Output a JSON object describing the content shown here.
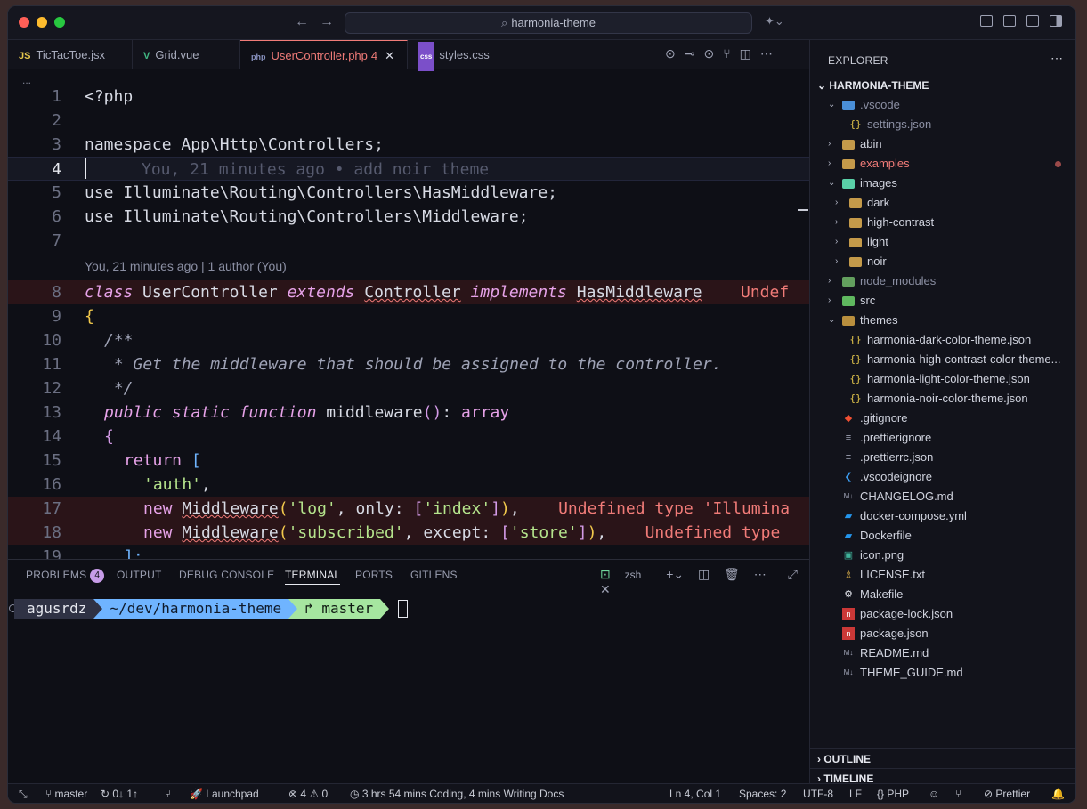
{
  "window": {
    "search_text": "harmonia-theme"
  },
  "tabs": [
    {
      "icon": "JS",
      "label": "TicTacToe.jsx"
    },
    {
      "icon": "V",
      "label": "Grid.vue"
    },
    {
      "icon": "php",
      "label": "UserController.php",
      "badge": "4"
    },
    {
      "icon": "css",
      "label": "styles.css"
    }
  ],
  "breadcrumb": "...",
  "code": {
    "line_numbers": [
      "1",
      "2",
      "3",
      "4",
      "5",
      "6",
      "7",
      "8",
      "9",
      "10",
      "11",
      "12",
      "13",
      "14",
      "15",
      "16",
      "17",
      "18",
      "19"
    ],
    "l1": "<?php",
    "l3": "namespace App\\Http\\Controllers;",
    "l4_ghost": "You, 21 minutes ago • add noir theme",
    "l5": "use Illuminate\\Routing\\Controllers\\HasMiddleware;",
    "l6": "use Illuminate\\Routing\\Controllers\\Middleware;",
    "blame": "You, 21 minutes ago | 1 author (You)",
    "l8_class": "class",
    "l8_name": "UserController",
    "l8_extends": "extends",
    "l8_parent": "Controller",
    "l8_implements": "implements",
    "l8_iface": "HasMiddleware",
    "l8_err": "Undef",
    "l10": "/**",
    "l11": " * Get the middleware that should be assigned to the controller.",
    "l12": " */",
    "l13_mods": "public static function",
    "l13_name": "middleware",
    "l13_ret": "array",
    "l15_return": "return",
    "l16_str": "'auth'",
    "l17_new": "new",
    "l17_cls": "Middleware",
    "l17_a": "'log'",
    "l17_b": "only:",
    "l17_c": "'index'",
    "l17_err": "Undefined type 'Illumina",
    "l18_new": "new",
    "l18_cls": "Middleware",
    "l18_a": "'subscribed'",
    "l18_b": "except:",
    "l18_c": "'store'",
    "l18_err": "Undefined type"
  },
  "panel": {
    "tabs": [
      "PROBLEMS",
      "OUTPUT",
      "DEBUG CONSOLE",
      "TERMINAL",
      "PORTS",
      "GITLENS"
    ],
    "problems_count": "4",
    "shell": "zsh",
    "prompt_user": "agusrdz",
    "prompt_path": "~/dev/harmonia-theme",
    "prompt_branch": "master"
  },
  "explorer": {
    "title": "EXPLORER",
    "root": "HARMONIA-THEME",
    "items": [
      {
        "label": ".vscode"
      },
      {
        "label": "settings.json"
      },
      {
        "label": "abin"
      },
      {
        "label": "examples"
      },
      {
        "label": "images"
      },
      {
        "label": "dark"
      },
      {
        "label": "high-contrast"
      },
      {
        "label": "light"
      },
      {
        "label": "noir"
      },
      {
        "label": "node_modules"
      },
      {
        "label": "src"
      },
      {
        "label": "themes"
      },
      {
        "label": "harmonia-dark-color-theme.json"
      },
      {
        "label": "harmonia-high-contrast-color-theme..."
      },
      {
        "label": "harmonia-light-color-theme.json"
      },
      {
        "label": "harmonia-noir-color-theme.json"
      },
      {
        "label": ".gitignore"
      },
      {
        "label": ".prettierignore"
      },
      {
        "label": ".prettierrc.json"
      },
      {
        "label": ".vscodeignore"
      },
      {
        "label": "CHANGELOG.md"
      },
      {
        "label": "docker-compose.yml"
      },
      {
        "label": "Dockerfile"
      },
      {
        "label": "icon.png"
      },
      {
        "label": "LICENSE.txt"
      },
      {
        "label": "Makefile"
      },
      {
        "label": "package-lock.json"
      },
      {
        "label": "package.json"
      },
      {
        "label": "README.md"
      },
      {
        "label": "THEME_GUIDE.md"
      }
    ],
    "outline": "OUTLINE",
    "timeline": "TIMELINE"
  },
  "status": {
    "branch": "master",
    "sync": "0↓ 1↑",
    "launchpad": "Launchpad",
    "errors": "4",
    "warnings": "0",
    "coding_time": "3 hrs 54 mins Coding, 4 mins Writing Docs",
    "position": "Ln 4, Col 1",
    "spaces": "Spaces: 2",
    "encoding": "UTF-8",
    "eol": "LF",
    "language": "PHP",
    "formatter": "Prettier"
  }
}
